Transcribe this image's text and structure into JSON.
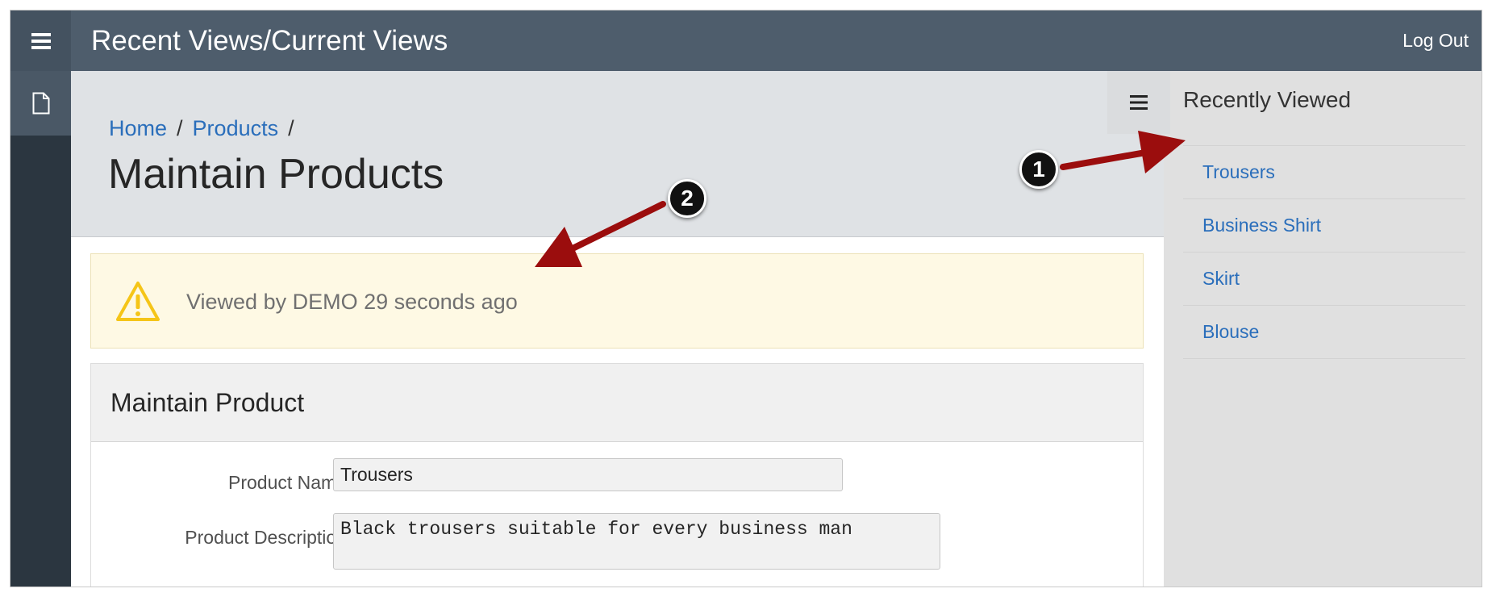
{
  "header": {
    "title": "Recent Views/Current Views",
    "logout_label": "Log Out"
  },
  "breadcrumb": {
    "items": [
      "Home",
      "Products"
    ],
    "separator": "/"
  },
  "page": {
    "title": "Maintain Products"
  },
  "alert": {
    "message": "Viewed by DEMO 29 seconds ago",
    "icon": "warning-icon"
  },
  "region": {
    "title": "Maintain Product"
  },
  "form": {
    "product_name_label": "Product Name",
    "product_name_value": "Trousers",
    "product_description_label": "Product Description",
    "product_description_value": "Black trousers suitable for every business man"
  },
  "recently_viewed": {
    "title": "Recently Viewed",
    "items": [
      "Trousers",
      "Business Shirt",
      "Skirt",
      "Blouse"
    ]
  },
  "callouts": [
    "1",
    "2"
  ],
  "colors": {
    "header_bg": "#4e5d6c",
    "sidebar_bg": "#2b3640",
    "link": "#2a6ebb",
    "alert_bg": "#fef9e4",
    "warning": "#f5c518",
    "arrow": "#9b0d0d"
  }
}
